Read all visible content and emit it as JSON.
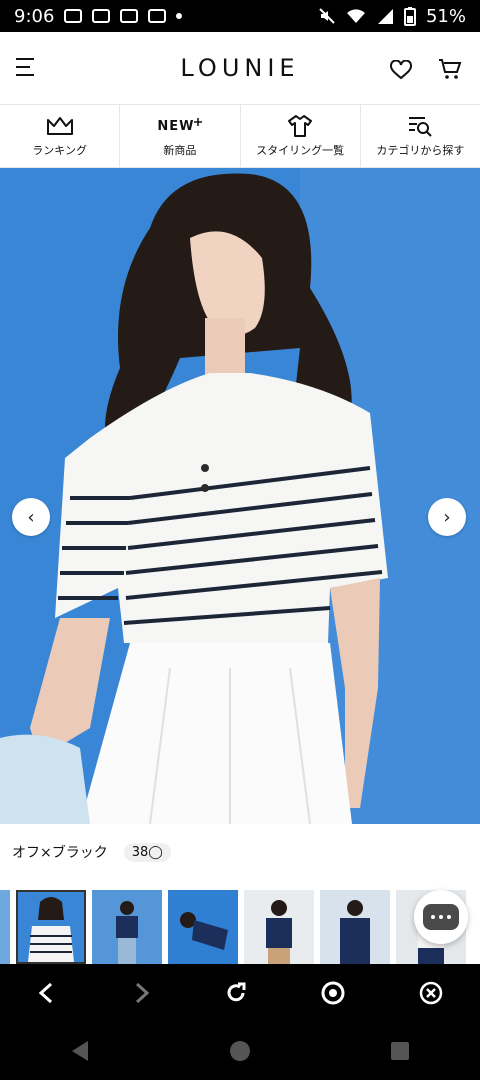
{
  "status_bar": {
    "time": "9:06",
    "battery": "51%",
    "app_icons": [
      "uniqlo-icon",
      "youtube-icon",
      "line-icon",
      "youtube-icon"
    ],
    "system_icons": [
      "mute-icon",
      "wifi-icon",
      "signal-icon",
      "battery-icon"
    ]
  },
  "header": {
    "logo": "LOUNIE",
    "icons": [
      "hamburger-menu-icon",
      "heart-icon",
      "cart-icon"
    ]
  },
  "nav": {
    "items": [
      {
        "label": "ランキング",
        "icon": "crown-icon"
      },
      {
        "label": "新商品",
        "icon": "new-badge-icon",
        "badge_text": "NEW"
      },
      {
        "label": "スタイリング一覧",
        "icon": "shirt-icon"
      },
      {
        "label": "カテゴリから探す",
        "icon": "category-search-icon"
      }
    ]
  },
  "hero": {
    "prev_arrow": "‹",
    "next_arrow": "›",
    "bg_color": "#3a86d6"
  },
  "product": {
    "color_name": "オフ×ブラック",
    "size_label": "38",
    "size_mark": "◯"
  },
  "thumbnails": [
    {
      "selected": false,
      "bg": "#6fa8df"
    },
    {
      "selected": true,
      "bg": "#3a86d6"
    },
    {
      "selected": false,
      "bg": "#5596d8"
    },
    {
      "selected": false,
      "bg": "#2f7fd2"
    },
    {
      "selected": false,
      "bg": "#e9ecef"
    },
    {
      "selected": false,
      "bg": "#d7e2ec"
    },
    {
      "selected": false,
      "bg": "#e5e8eb"
    }
  ],
  "browser_bar": {
    "icons": [
      "back-icon",
      "forward-icon",
      "reload-icon",
      "chrome-icon",
      "close-icon"
    ]
  },
  "system_nav": {
    "icons": [
      "back-triangle-icon",
      "home-circle-icon",
      "recents-square-icon"
    ]
  }
}
